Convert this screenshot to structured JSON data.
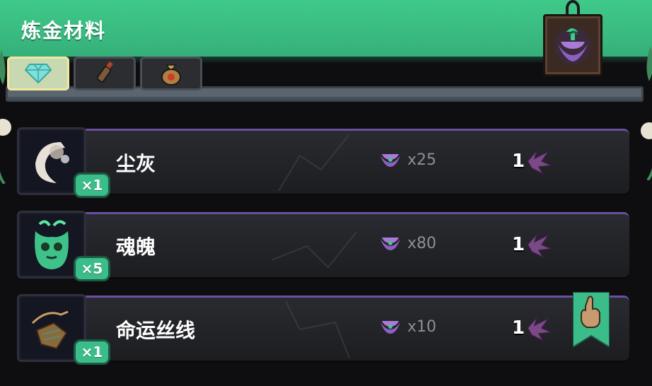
{
  "header": {
    "title": "炼金材料",
    "color": "#3fc98a"
  },
  "tabs": [
    {
      "icon": "gem-icon",
      "active": true
    },
    {
      "icon": "vial-icon",
      "active": false
    },
    {
      "icon": "money-bag-icon",
      "active": false
    }
  ],
  "items": [
    {
      "name": "尘灰",
      "qty": "×1",
      "price": "x25",
      "owned": "1",
      "icon": "dust-icon"
    },
    {
      "name": "魂魄",
      "qty": "×5",
      "price": "x80",
      "owned": "1",
      "icon": "soul-icon"
    },
    {
      "name": "命运丝线",
      "qty": "×1",
      "price": "x10",
      "owned": "1",
      "icon": "fate-thread-icon"
    }
  ],
  "colors": {
    "accent": "#3bbd8a",
    "panel_border": "#6a4fa3",
    "currency": "#8d5fc4"
  }
}
